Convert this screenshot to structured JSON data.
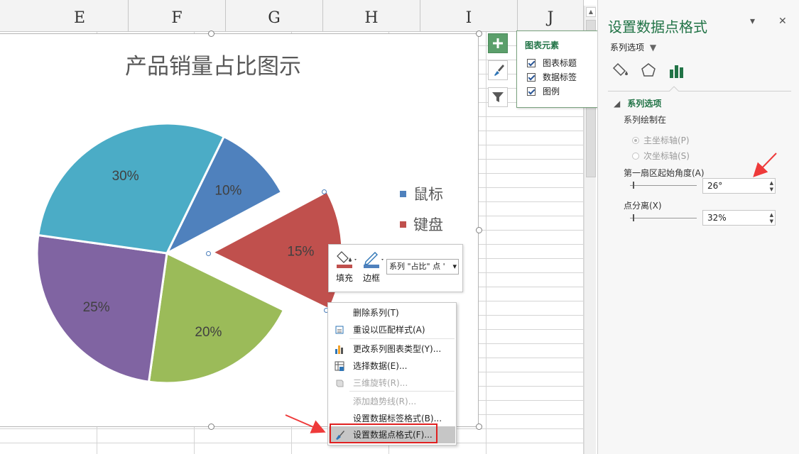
{
  "sheet": {
    "columns": [
      "E",
      "F",
      "G",
      "H",
      "I",
      "J"
    ]
  },
  "chart": {
    "title": "产品销量占比图示"
  },
  "chart_data": {
    "type": "pie",
    "title": "产品销量占比图示",
    "labels": [
      "10%",
      "15%",
      "20%",
      "25%",
      "30%"
    ],
    "values": [
      10,
      15,
      20,
      25,
      30
    ],
    "colors": [
      "#4f81bd",
      "#c0504d",
      "#9bbb59",
      "#8064a2",
      "#4bacc6"
    ],
    "first_slice_angle_deg": 26,
    "point_explosion_pct": 32,
    "exploded_point_index": 1,
    "legend": {
      "position": "right",
      "entries": [
        {
          "name": "鼠标",
          "color": "#4f81bd"
        },
        {
          "name": "键盘",
          "color": "#c0504d"
        }
      ]
    }
  },
  "elements_popup": {
    "title": "图表元素",
    "items": [
      {
        "label": "图表标题",
        "checked": true
      },
      {
        "label": "数据标签",
        "checked": true
      },
      {
        "label": "图例",
        "checked": true
      }
    ]
  },
  "mini_toolbar": {
    "fill_label": "填充",
    "border_label": "边框",
    "series_select": "系列 \"占比\" 点 '"
  },
  "context_menu": {
    "items": [
      {
        "label": "删除系列(T)",
        "disabled": false,
        "icon": "delete-icon"
      },
      {
        "label": "重设以匹配样式(A)",
        "disabled": false,
        "icon": "reset-style-icon"
      },
      {
        "label": "更改系列图表类型(Y)...",
        "disabled": false,
        "icon": "chart-type-icon"
      },
      {
        "label": "选择数据(E)...",
        "disabled": false,
        "icon": "select-data-icon"
      },
      {
        "label": "三维旋转(R)...",
        "disabled": true,
        "icon": "3d-rotate-icon"
      },
      {
        "label": "添加趋势线(R)...",
        "disabled": true,
        "icon": ""
      },
      {
        "label": "设置数据标签格式(B)...",
        "disabled": false,
        "icon": ""
      },
      {
        "label": "设置数据点格式(F)...",
        "disabled": false,
        "icon": "format-point-icon",
        "highlighted": true
      }
    ]
  },
  "pane": {
    "title": "设置数据点格式",
    "dropdown": "系列选项",
    "section": "系列选项",
    "plot_on_label": "系列绘制在",
    "primary_axis": "主坐标轴(P)",
    "secondary_axis": "次坐标轴(S)",
    "angle_label": "第一扇区起始角度(A)",
    "angle_value": "26°",
    "explosion_label": "点分离(X)",
    "explosion_value": "32%",
    "colors": {
      "accent": "#217346"
    }
  }
}
